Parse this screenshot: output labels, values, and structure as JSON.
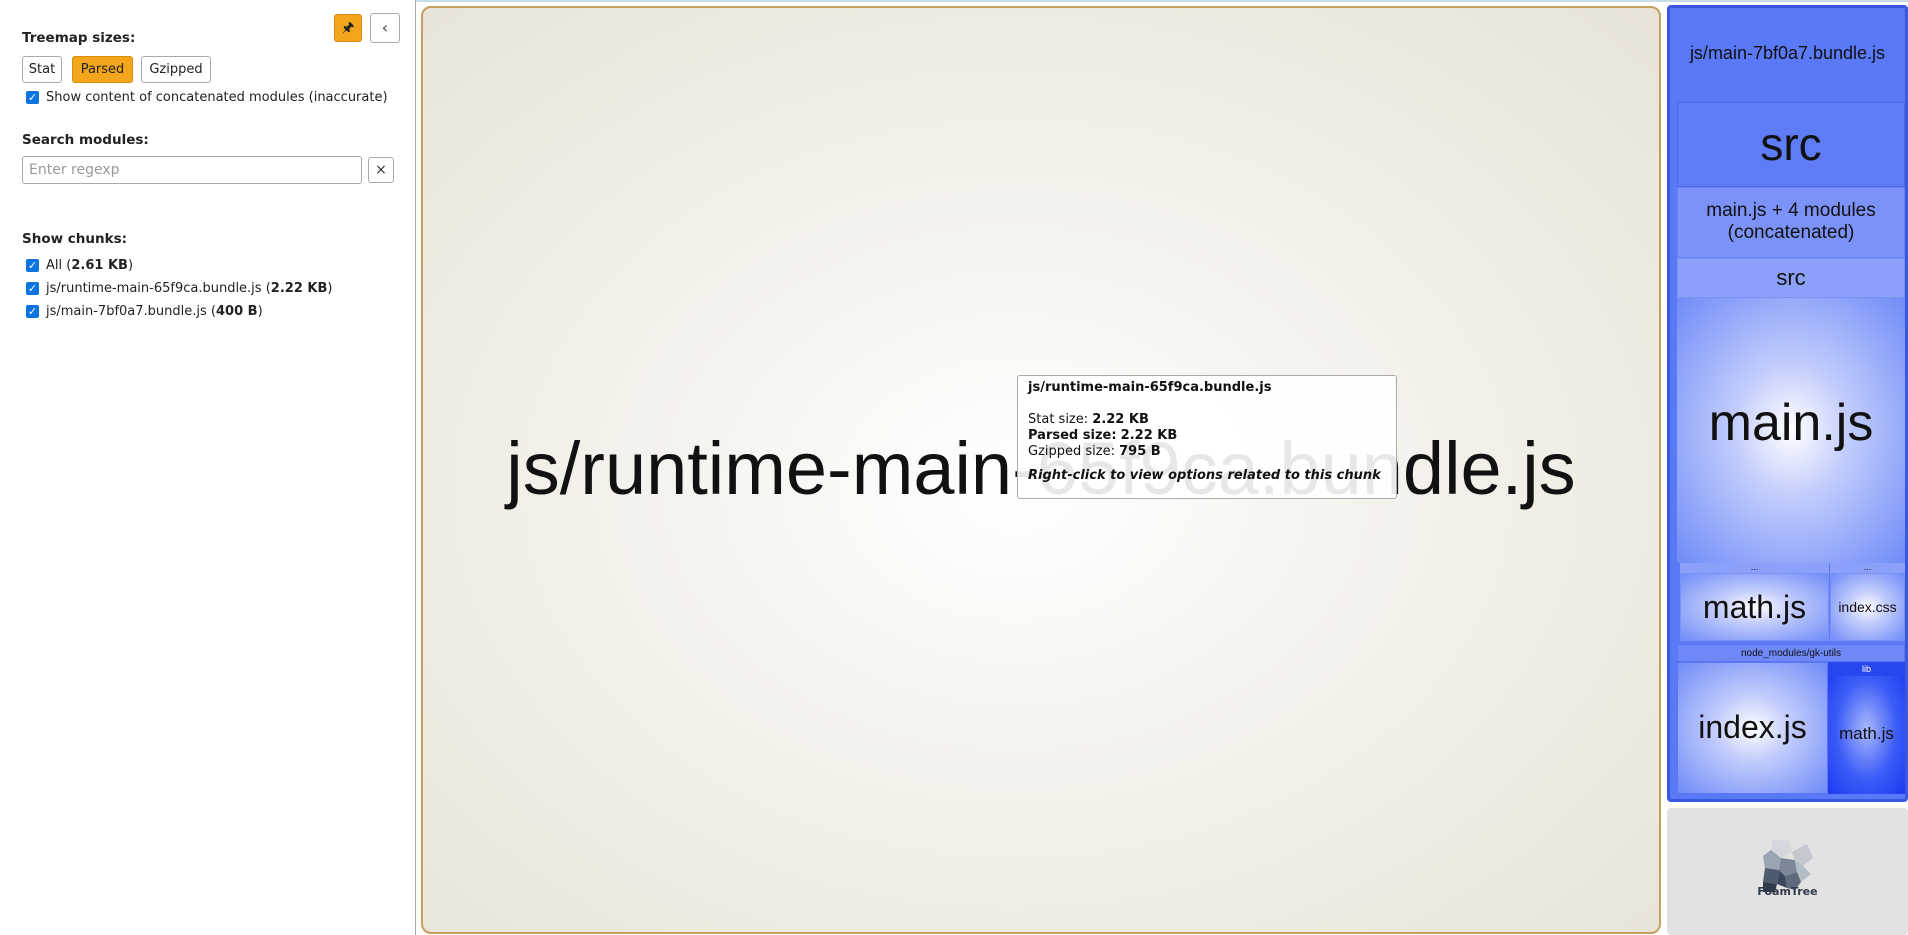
{
  "sidebar": {
    "pin_icon": "🖈",
    "collapse_icon": "‹",
    "treemap_sizes_label": "Treemap sizes:",
    "size_options": [
      "Stat",
      "Parsed",
      "Gzipped"
    ],
    "size_selected": "Parsed",
    "show_concatenated_label": "Show content of concatenated modules (inaccurate)",
    "search_label": "Search modules:",
    "search_placeholder": "Enter regexp",
    "search_clear": "×",
    "show_chunks_label": "Show chunks:",
    "chunks": [
      {
        "name": "All",
        "size": "2.61 KB"
      },
      {
        "name": "js/runtime-main-65f9ca.bundle.js",
        "size": "2.22 KB"
      },
      {
        "name": "js/main-7bf0a7.bundle.js",
        "size": "400 B"
      }
    ]
  },
  "treemap": {
    "runtime_chunk": "js/runtime-main-65f9ca.bundle.js",
    "main_chunk": "js/main-7bf0a7.bundle.js",
    "src": "src",
    "concat_line1": "main.js + 4 modules",
    "concat_line2": "(concatenated)",
    "src_inner": "src",
    "main_js": "main.js",
    "ellipsis1": "...",
    "ellipsis2": "...",
    "math_js": "math.js",
    "index_css": "index.css",
    "node_modules": "node_modules/gk-utils",
    "index_js": "index.js",
    "lib": "lib",
    "lib_math_js": "math.js",
    "foamtree": "FoamTree"
  },
  "tooltip": {
    "title": "js/runtime-main-65f9ca.bundle.js",
    "stat_label": "Stat size:",
    "stat_value": "2.22 KB",
    "parsed_label": "Parsed size:",
    "parsed_value": "2.22 KB",
    "gzip_label": "Gzipped size:",
    "gzip_value": "795 B",
    "hint": "Right-click to view options related to this chunk"
  }
}
